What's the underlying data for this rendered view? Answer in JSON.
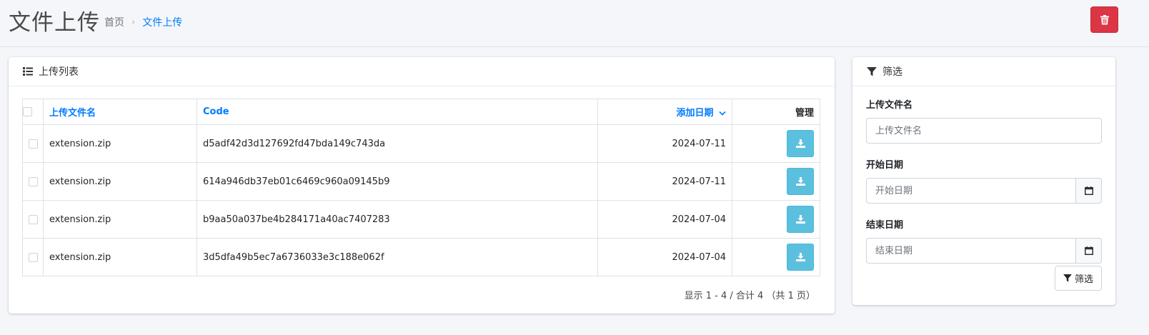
{
  "header": {
    "title": "文件上传",
    "breadcrumb": {
      "home": "首页",
      "current": "文件上传"
    }
  },
  "list_card": {
    "title": "上传列表",
    "columns": {
      "name": "上传文件名",
      "code": "Code",
      "date": "添加日期",
      "manage": "管理"
    },
    "rows": [
      {
        "name": "extension.zip",
        "code": "d5adf42d3d127692fd47bda149c743da",
        "date": "2024-07-11"
      },
      {
        "name": "extension.zip",
        "code": "614a946db37eb01c6469c960a09145b9",
        "date": "2024-07-11"
      },
      {
        "name": "extension.zip",
        "code": "b9aa50a037be4b284171a40ac7407283",
        "date": "2024-07-04"
      },
      {
        "name": "extension.zip",
        "code": "3d5dfa49b5ec7a6736033e3c188e062f",
        "date": "2024-07-04"
      }
    ],
    "pagination": "显示 1 - 4 / 合计 4 （共 1 页）"
  },
  "filter_card": {
    "title": "筛选",
    "fields": {
      "filename": {
        "label": "上传文件名",
        "placeholder": "上传文件名",
        "value": ""
      },
      "start_date": {
        "label": "开始日期",
        "placeholder": "开始日期",
        "value": ""
      },
      "end_date": {
        "label": "结束日期",
        "placeholder": "结束日期",
        "value": ""
      }
    },
    "submit_label": "筛选"
  },
  "colors": {
    "accent": "#007bff",
    "danger": "#dc3545",
    "info": "#5bc0de"
  },
  "icons": {
    "delete": "trash-icon",
    "list": "list-icon",
    "filter": "filter-icon",
    "download": "download-icon",
    "calendar": "calendar-icon",
    "sort": "chevron-down-icon"
  }
}
